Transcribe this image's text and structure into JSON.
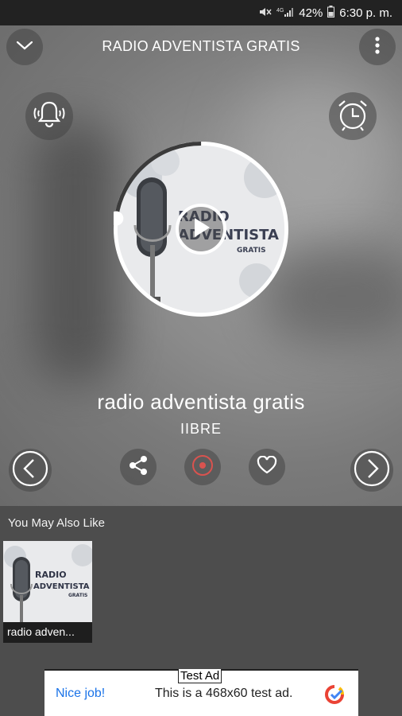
{
  "status_bar": {
    "battery": "42%",
    "time": "6:30 p. m."
  },
  "header": {
    "title": "RADIO ADVENTISTA GRATIS"
  },
  "artwork": {
    "line1": "RADIO",
    "line2": "ADVENTISTA",
    "line3": "GRATIS"
  },
  "station": {
    "name": "radio adventista gratis",
    "subtitle": "IIBRE"
  },
  "progress": 0.23,
  "similar": {
    "title": "You May Also Like",
    "items": [
      {
        "label": "radio adven...",
        "art1": "RADIO",
        "art2": "ADVENTISTA",
        "art3": "GRATIS"
      }
    ]
  },
  "ad": {
    "tag": "Test Ad",
    "nice": "Nice job!",
    "text": "This is a 468x60 test ad."
  },
  "colors": {
    "accent_record": "#d9534f",
    "ad_link": "#1a73e8"
  },
  "icons": [
    "mute-icon",
    "signal-icon",
    "battery-icon",
    "chevron-down-icon",
    "more-vert-icon",
    "bell-icon",
    "alarm-clock-icon",
    "play-icon",
    "prev-icon",
    "share-icon",
    "record-icon",
    "heart-icon",
    "next-icon",
    "adchoices-icon"
  ]
}
